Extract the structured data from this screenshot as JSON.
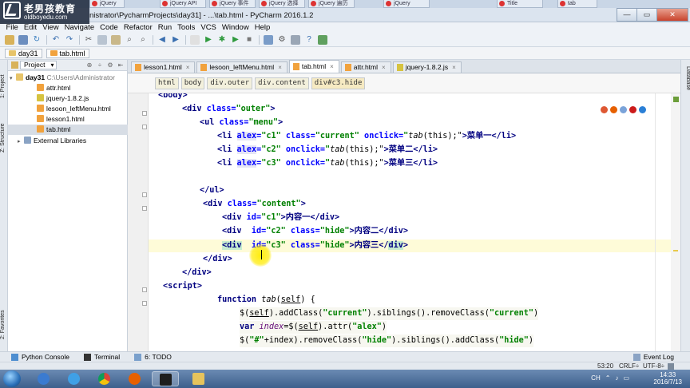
{
  "logo": {
    "cn": "老男孩教育",
    "en": "oldboyedu.com"
  },
  "browser_tabs": [
    "jQuery",
    "jQuery API",
    "jQuery 事件",
    "jQuery 选择",
    "jQuery 遍历",
    "jQuery",
    "Title",
    "tab"
  ],
  "window": {
    "title": "nistrator\\PycharmProjects\\day31] - ...\\tab.html - PyCharm 2016.1.2",
    "min": "—",
    "max": "▭",
    "close": "✕"
  },
  "menu": [
    "File",
    "Edit",
    "View",
    "Navigate",
    "Code",
    "Refactor",
    "Run",
    "Tools",
    "VCS",
    "Window",
    "Help"
  ],
  "nav_crumbs": [
    "day31",
    "tab.html"
  ],
  "project_panel": {
    "selector": "Project",
    "tree": [
      {
        "label": "day31",
        "detail": "C:\\Users\\Administrator",
        "type": "folder",
        "indent": 0,
        "arrow": "▾"
      },
      {
        "label": "attr.html",
        "type": "html",
        "indent": 1
      },
      {
        "label": "jquery-1.8.2.js",
        "type": "js",
        "indent": 1
      },
      {
        "label": "lesoon_leftMenu.html",
        "type": "html",
        "indent": 1
      },
      {
        "label": "lesson1.html",
        "type": "html",
        "indent": 1
      },
      {
        "label": "tab.html",
        "type": "html",
        "indent": 1,
        "selected": true
      },
      {
        "label": "External Libraries",
        "type": "lib",
        "indent": 0,
        "arrow": "▸"
      }
    ]
  },
  "left_strip": [
    "1: Project",
    "Z: Structure",
    "2: Favorites"
  ],
  "right_strip": [
    "Database"
  ],
  "editor_tabs": [
    {
      "label": "lesson1.html",
      "type": "html"
    },
    {
      "label": "lesoon_leftMenu.html",
      "type": "html"
    },
    {
      "label": "tab.html",
      "type": "html",
      "active": true
    },
    {
      "label": "attr.html",
      "type": "html"
    },
    {
      "label": "jquery-1.8.2.js",
      "type": "js"
    }
  ],
  "tag_path": [
    "html",
    "body",
    "div.outer",
    "div.content",
    "div#c3.hide"
  ],
  "code": {
    "l1": "<body>",
    "l2a": "<div ",
    "l2b": "class=",
    "l2c": "\"outer\"",
    "l2d": ">",
    "l3a": "<ul ",
    "l3b": "class=",
    "l3c": "\"menu\"",
    "l3d": ">",
    "l4a": "<li ",
    "l4b": "alex",
    "l4c": "=",
    "l4d": "\"c1\"",
    "l4e": " class=",
    "l4f": "\"current\"",
    "l4g": " onclick=",
    "l4h": "\"",
    "l4i": "tab",
    "l4j": "(this);\"",
    "l4k": ">菜单一</",
    "l4l": "li",
    "l4m": ">",
    "l5a": "<li ",
    "l5b": "alex",
    "l5c": "=",
    "l5d": "\"c2\"",
    "l5e": " onclick=",
    "l5f": "\"",
    "l5g": "tab",
    "l5h": "(this);\"",
    "l5i": ">菜单二</",
    "l5j": "li",
    "l5k": ">",
    "l6a": "<li ",
    "l6b": "alex",
    "l6c": "=",
    "l6d": "\"c3\"",
    "l6e": " onclick=",
    "l6f": "\"",
    "l6g": "tab",
    "l6h": "(this);\"",
    "l6i": ">菜单三</",
    "l6j": "li",
    "l6k": ">",
    "l8": "</ul>",
    "l9a": "<div ",
    "l9b": "class=",
    "l9c": "\"content\"",
    "l9d": ">",
    "l10a": "<div ",
    "l10b": "id=",
    "l10c": "\"c1\"",
    "l10d": ">内容一</",
    "l10e": "div",
    "l10f": ">",
    "l11a": "<div  ",
    "l11b": "id=",
    "l11c": "\"c2\"",
    "l11d": " class=",
    "l11e": "\"hide\"",
    "l11f": ">内容二</",
    "l11g": "div",
    "l11h": ">",
    "l12a": "<div",
    "l12b": "  id=",
    "l12c": "\"c3\"",
    "l12d": " class=",
    "l12e": "\"hide\"",
    "l12f": ">内容三</",
    "l12g": "div",
    "l12h": ">",
    "l13": "</div>",
    "l14": "</div>",
    "l15": "<script>",
    "l16a": "function ",
    "l16b": "tab",
    "l16c": "(",
    "l16d": "self",
    "l16e": ") {",
    "l17a": "$(",
    "l17b": "self",
    "l17c": ").addClass(",
    "l17d": "\"current\"",
    "l17e": ").siblings().removeClass(",
    "l17f": "\"current\"",
    "l17g": ")",
    "l18a": "var ",
    "l18b": "index",
    "l18c": "=$(",
    "l18d": "self",
    "l18e": ").attr(",
    "l18f": "\"alex\"",
    "l18g": ")",
    "l19a": "$(",
    "l19b": "\"#\"",
    "l19c": "+index).removeClass(",
    "l19d": "\"hide\"",
    "l19e": ").siblings().addClass(",
    "l19f": "\"hide\"",
    "l19g": ")"
  },
  "bottom_tools": [
    {
      "label": "Python Console",
      "icon": "python-icon"
    },
    {
      "label": "Terminal",
      "icon": "terminal-icon"
    },
    {
      "label": "6: TODO",
      "icon": "todo-icon"
    }
  ],
  "event_log": "Event Log",
  "status": {
    "position": "53:20",
    "line_sep": "CRLF÷",
    "encoding": "UTF-8÷"
  },
  "taskbar": {
    "time": "14:33",
    "date": "2016/7/13",
    "tray": [
      "CH",
      "⌃",
      "♪",
      "▭"
    ]
  },
  "colors": {
    "tag": "#000080",
    "attr": "#0000ff",
    "string": "#008000",
    "caret_line": "#fefbd8"
  }
}
